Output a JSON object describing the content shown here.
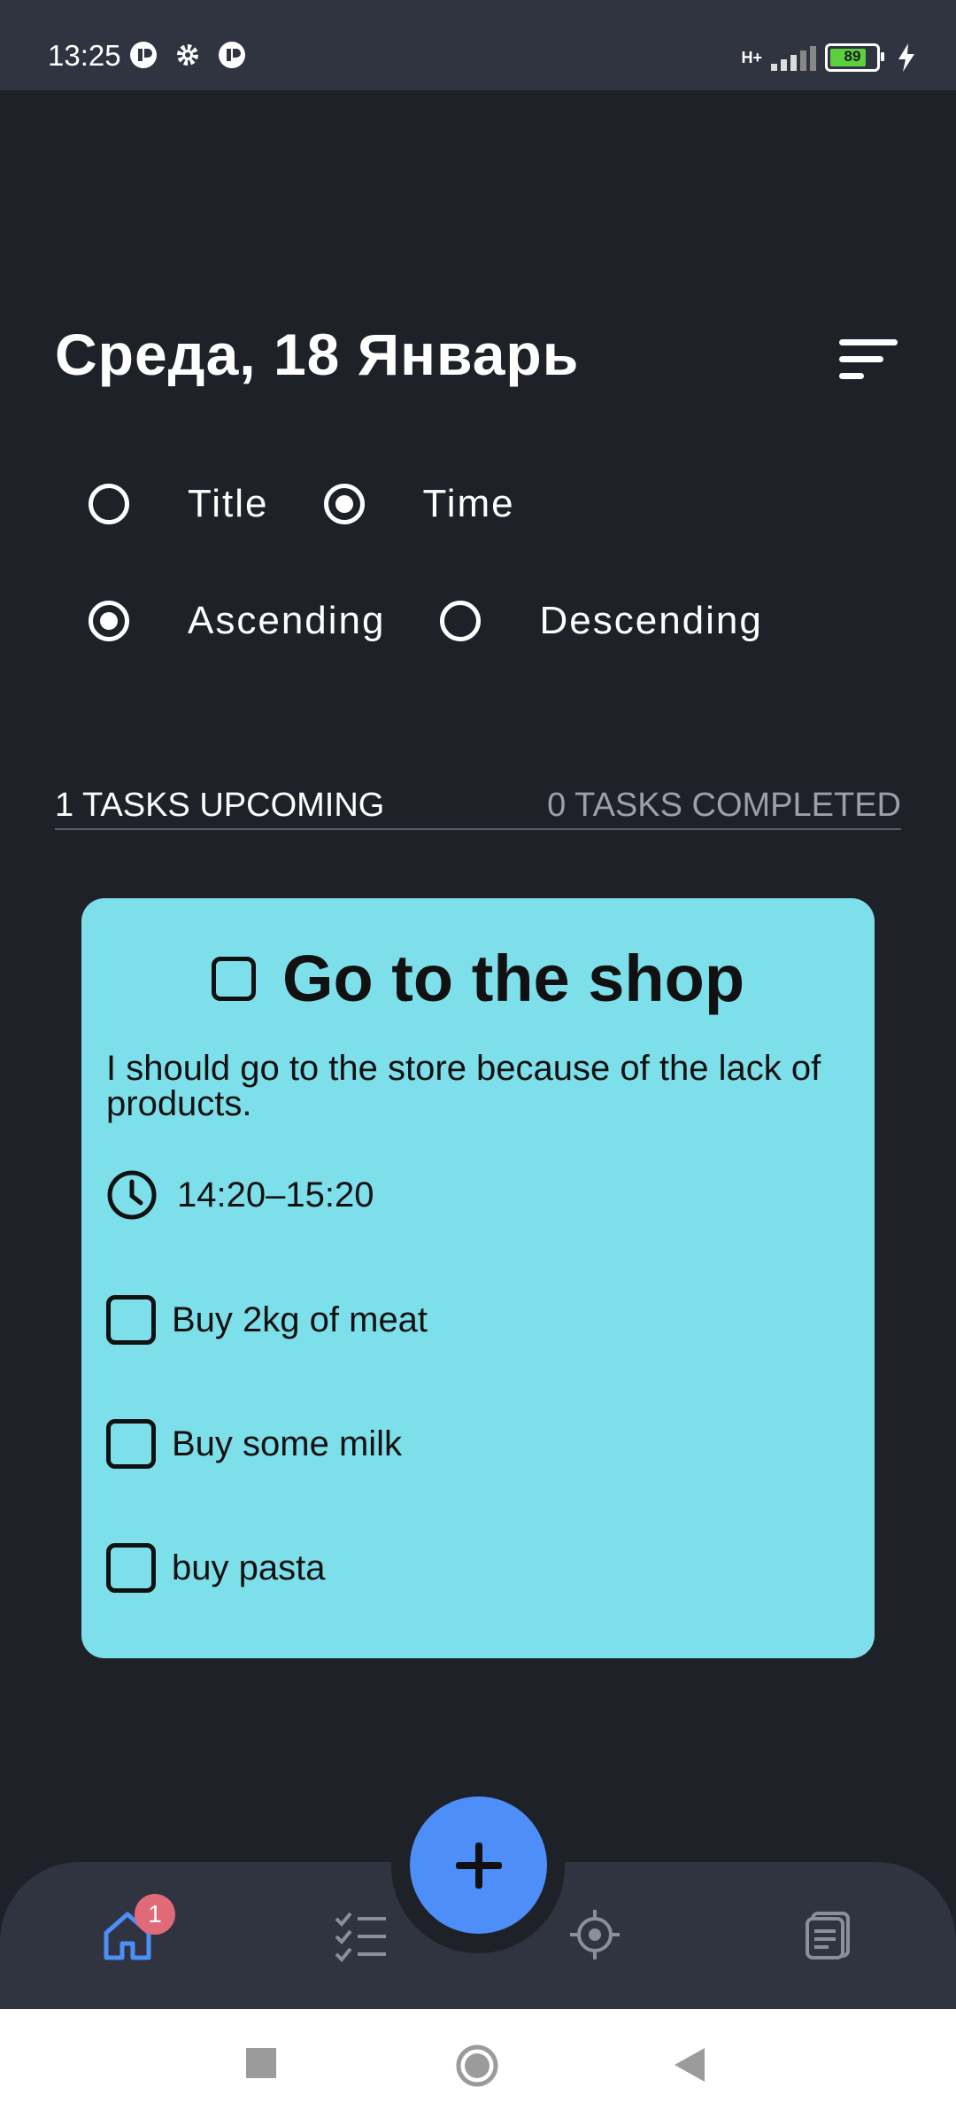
{
  "status_bar": {
    "time": "13:25",
    "network": "H+",
    "battery": "89"
  },
  "header": {
    "date": "Среда, 18 Январь"
  },
  "sort": {
    "by": [
      {
        "label": "Title",
        "selected": false
      },
      {
        "label": "Time",
        "selected": true
      }
    ],
    "order": [
      {
        "label": "Ascending",
        "selected": true
      },
      {
        "label": "Descending",
        "selected": false
      }
    ]
  },
  "counts": {
    "upcoming": "1 TASKS UPCOMING",
    "completed": "0 TASKS COMPLETED"
  },
  "task": {
    "title": "Go to the shop",
    "description": "I should go to the store because of the lack of products.",
    "time": "14:20–15:20",
    "subtasks": [
      {
        "label": "Buy 2kg of meat",
        "checked": false
      },
      {
        "label": "Buy some milk",
        "checked": false
      },
      {
        "label": "buy pasta",
        "checked": false
      }
    ],
    "color": "#7ddfea"
  },
  "nav": {
    "items": [
      "home-icon",
      "tasks-icon",
      "focus-icon",
      "notes-icon"
    ],
    "home_badge": "1",
    "accent": "#4d8ef8"
  }
}
